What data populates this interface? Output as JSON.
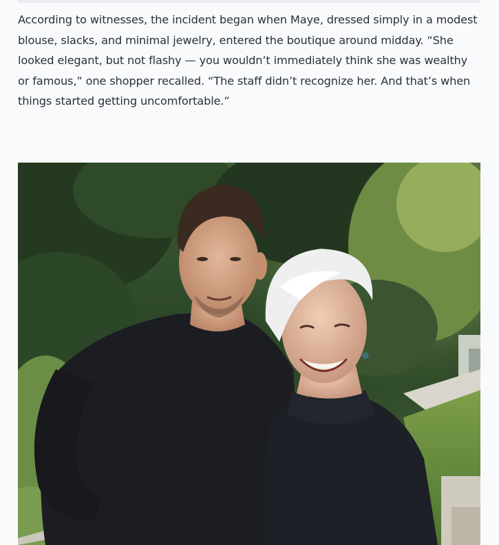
{
  "article": {
    "paragraph": "According to witnesses, the incident began when Maye, dressed simply in a modest blouse, slacks, and minimal jewelry, entered the boutique around midday. “She looked elegant, but not flashy — you wouldn’t immediately think she was wealthy or famous,” one shopper recalled. “The staff didn’t recognize her. And that’s when things started getting uncomfortable.”"
  },
  "colors": {
    "page_background": "#f9fafb",
    "body_text": "#2a3139",
    "foliage_dark": "#1f3320",
    "foliage_light": "#8fae55",
    "sweater": "#1b1d22"
  }
}
